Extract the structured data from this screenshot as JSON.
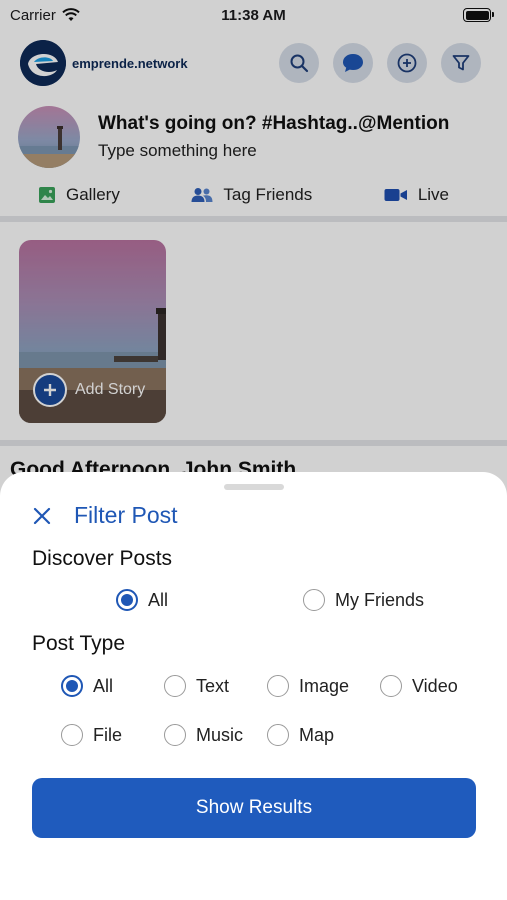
{
  "status_bar": {
    "carrier": "Carrier",
    "time": "11:38 AM"
  },
  "header": {
    "brand": "emprende.network"
  },
  "composer": {
    "title": "What's going on? #Hashtag..@Mention",
    "subtitle": "Type something here"
  },
  "post_actions": [
    {
      "label": "Gallery",
      "icon": "gallery-icon",
      "color": "#3aa35b"
    },
    {
      "label": "Tag Friends",
      "icon": "tag-friends-icon",
      "color": "#2f5fb8"
    },
    {
      "label": "Live",
      "icon": "video-camera-icon",
      "color": "#1f4fb0"
    }
  ],
  "story": {
    "add_label": "Add Story"
  },
  "greeting": "Good Afternoon, John Smith",
  "filter_sheet": {
    "title": "Filter Post",
    "discover": {
      "label": "Discover Posts",
      "options": [
        "All",
        "My Friends"
      ],
      "selected": "All"
    },
    "post_type": {
      "label": "Post Type",
      "options": [
        "All",
        "Text",
        "Image",
        "Video",
        "File",
        "Music",
        "Map"
      ],
      "selected": "All"
    },
    "submit_label": "Show Results"
  },
  "colors": {
    "accent": "#1f57b5",
    "button": "#1f5bbd",
    "brand_dark": "#0e2a57"
  }
}
